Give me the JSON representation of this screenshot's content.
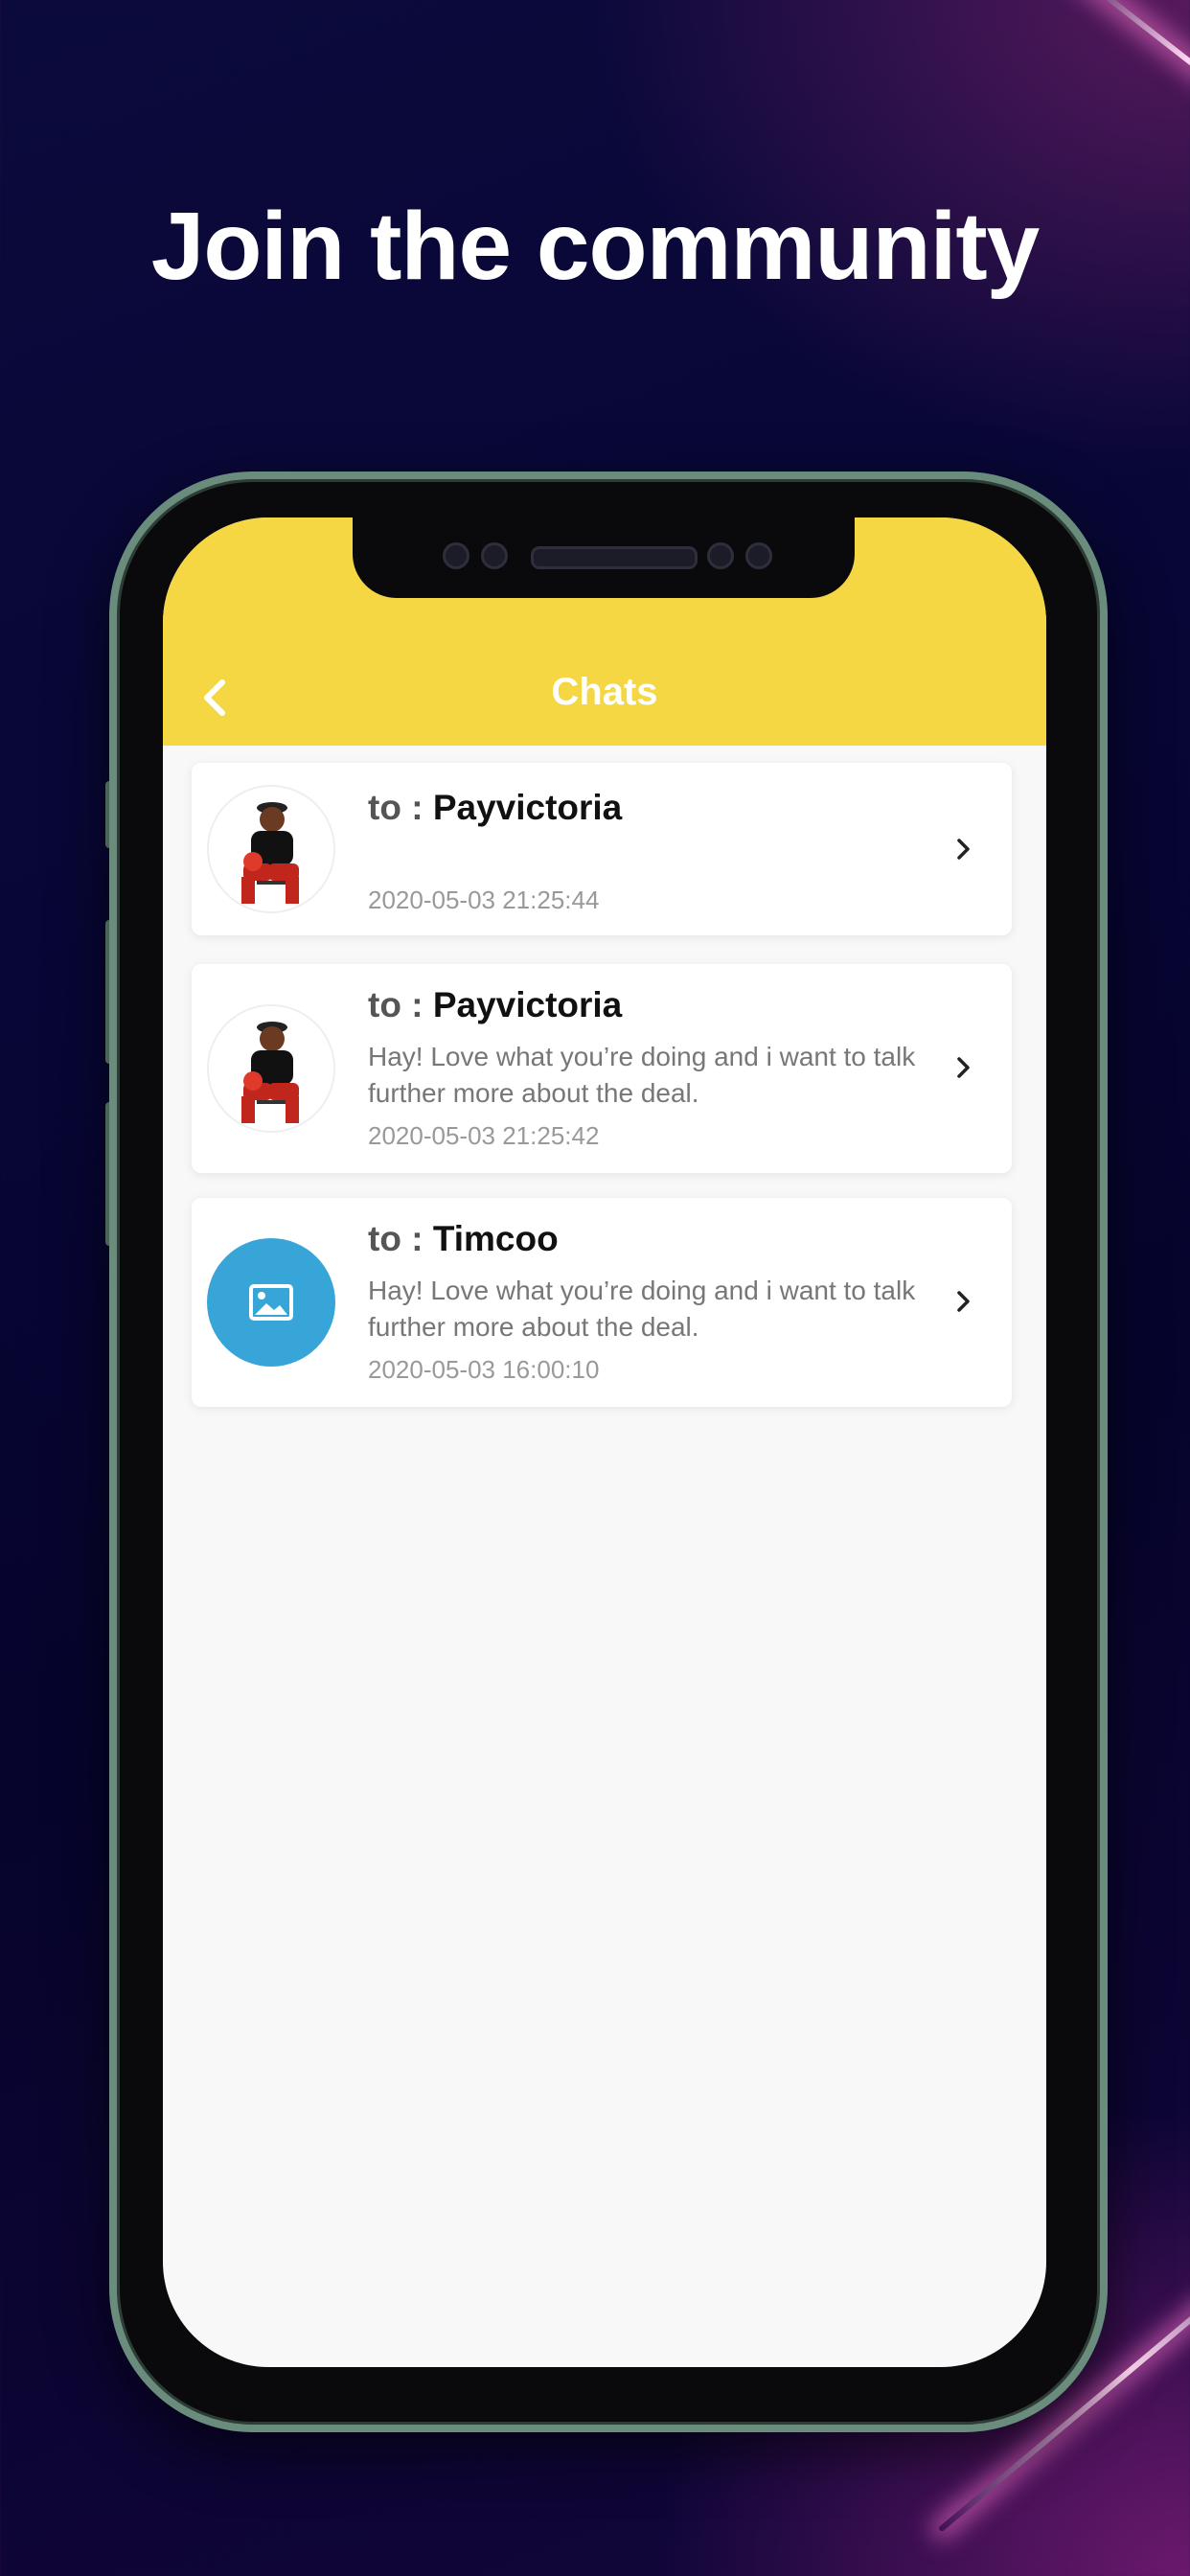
{
  "headline": "Join the community",
  "appbar": {
    "title": "Chats",
    "back_icon": "chevron-left-icon",
    "color": "#f4d743"
  },
  "chats": [
    {
      "to_label": "to :",
      "name": "Payvictoria",
      "preview": "",
      "timestamp": "2020-05-03 21:25:44",
      "avatar": "user-photo"
    },
    {
      "to_label": "to :",
      "name": "Payvictoria",
      "preview": "Hay! Love what you’re doing and i want to talk further more about the deal.",
      "timestamp": "2020-05-03 21:25:42",
      "avatar": "user-photo"
    },
    {
      "to_label": "to :",
      "name": "Timcoo",
      "preview": "Hay! Love what you’re doing and i want to talk further more about the deal.",
      "timestamp": "2020-05-03 16:00:10",
      "avatar": "image-placeholder-icon"
    }
  ]
}
